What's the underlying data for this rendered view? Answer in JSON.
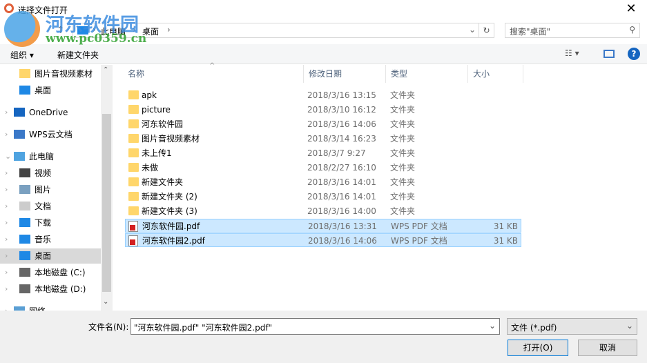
{
  "window": {
    "title": "选择文件打开",
    "close": "✕"
  },
  "watermark": {
    "name": "河东软件园",
    "url": "www.pc0359.cn"
  },
  "address": {
    "crumbs": [
      "此电脑",
      "桌面"
    ],
    "search_placeholder": "搜索\"桌面\""
  },
  "toolbar": {
    "organize": "组织 ▾",
    "new_folder": "新建文件夹"
  },
  "sidebar": [
    {
      "label": "图片音视频素材",
      "chev": ""
    },
    {
      "label": "桌面",
      "chev": ""
    },
    {
      "label": "OneDrive",
      "chev": "›"
    },
    {
      "label": "WPS云文档",
      "chev": "›"
    },
    {
      "label": "此电脑",
      "chev": "⌄"
    },
    {
      "label": "视频",
      "chev": "›"
    },
    {
      "label": "图片",
      "chev": "›"
    },
    {
      "label": "文档",
      "chev": "›"
    },
    {
      "label": "下载",
      "chev": "›"
    },
    {
      "label": "音乐",
      "chev": "›"
    },
    {
      "label": "桌面",
      "chev": "›"
    },
    {
      "label": "本地磁盘 (C:)",
      "chev": "›"
    },
    {
      "label": "本地磁盘 (D:)",
      "chev": "›"
    },
    {
      "label": "网络",
      "chev": "›"
    }
  ],
  "columns": {
    "name": "名称",
    "date": "修改日期",
    "type": "类型",
    "size": "大小"
  },
  "files": [
    {
      "name": "apk",
      "date": "2018/3/16 13:15",
      "type": "文件夹",
      "size": ""
    },
    {
      "name": "picture",
      "date": "2018/3/10 16:12",
      "type": "文件夹",
      "size": ""
    },
    {
      "name": "河东软件园",
      "date": "2018/3/16 14:06",
      "type": "文件夹",
      "size": ""
    },
    {
      "name": "图片音视频素材",
      "date": "2018/3/14 16:23",
      "type": "文件夹",
      "size": ""
    },
    {
      "name": "未上传1",
      "date": "2018/3/7 9:27",
      "type": "文件夹",
      "size": ""
    },
    {
      "name": "未做",
      "date": "2018/2/27 16:10",
      "type": "文件夹",
      "size": ""
    },
    {
      "name": "新建文件夹",
      "date": "2018/3/16 14:01",
      "type": "文件夹",
      "size": ""
    },
    {
      "name": "新建文件夹 (2)",
      "date": "2018/3/16 14:01",
      "type": "文件夹",
      "size": ""
    },
    {
      "name": "新建文件夹 (3)",
      "date": "2018/3/16 14:00",
      "type": "文件夹",
      "size": ""
    },
    {
      "name": "河东软件园.pdf",
      "date": "2018/3/16 13:31",
      "type": "WPS PDF 文档",
      "size": "31 KB"
    },
    {
      "name": "河东软件园2.pdf",
      "date": "2018/3/16 14:06",
      "type": "WPS PDF 文档",
      "size": "31 KB"
    }
  ],
  "bottom": {
    "filename_label": "文件名(N):",
    "filename_value": "\"河东软件园.pdf\" \"河东软件园2.pdf\"",
    "filter": "文件 (*.pdf)",
    "open": "打开(O)",
    "cancel": "取消"
  }
}
